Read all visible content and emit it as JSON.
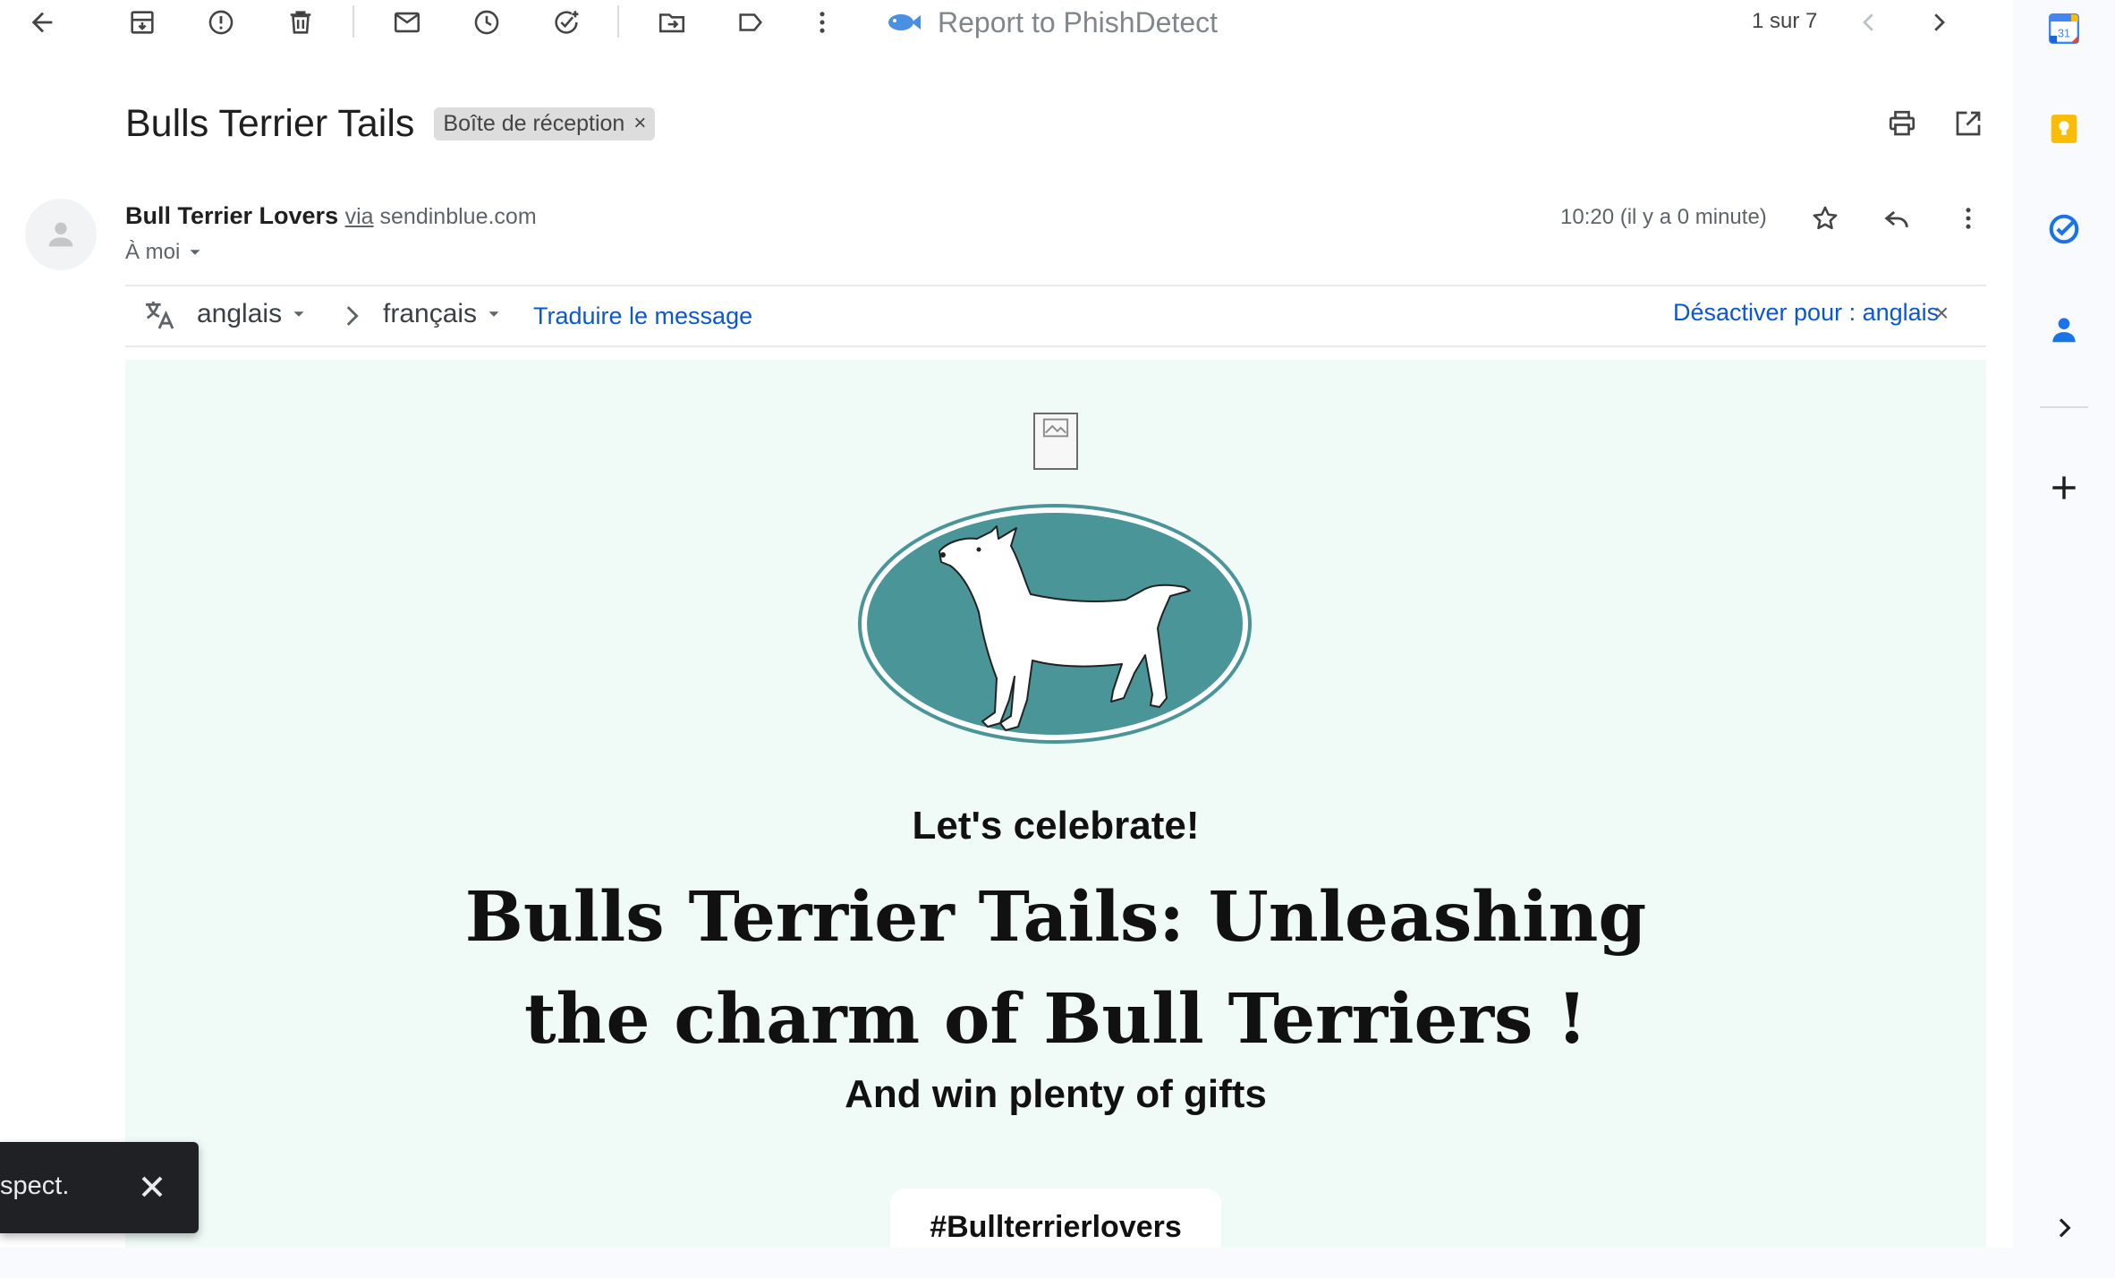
{
  "toolbar": {
    "phish_label": "Report to PhishDetect",
    "pagination": "1 sur 7"
  },
  "message": {
    "subject": "Bulls Terrier Tails",
    "label_chip": "Boîte de réception",
    "label_remove": "×",
    "sender_name": "Bull Terrier Lovers",
    "via_word": "via",
    "via_domain": "sendinblue.com",
    "recipient": "À moi",
    "timestamp": "10:20 (il y a 0 minute)"
  },
  "translate": {
    "source_lang": "anglais",
    "target_lang": "français",
    "translate_link": "Traduire le message",
    "disable_link": "Désactiver pour : anglais",
    "close": "×"
  },
  "email": {
    "celebrate": "Let's celebrate!",
    "headline_line1": "Bulls Terrier Tails: Unleashing",
    "headline_line2": "the charm of Bull Terriers !",
    "subheadline": "And win plenty of gifts",
    "hashtag": "#Bullterrierlovers"
  },
  "side_panel": {
    "calendar_day": "31"
  },
  "snackbar": {
    "text": "spect."
  },
  "colors": {
    "accent_blue": "#0b57d0",
    "email_bg": "#f0fbf7",
    "logo_teal": "#4a9597",
    "snackbar_bg": "#202124"
  }
}
